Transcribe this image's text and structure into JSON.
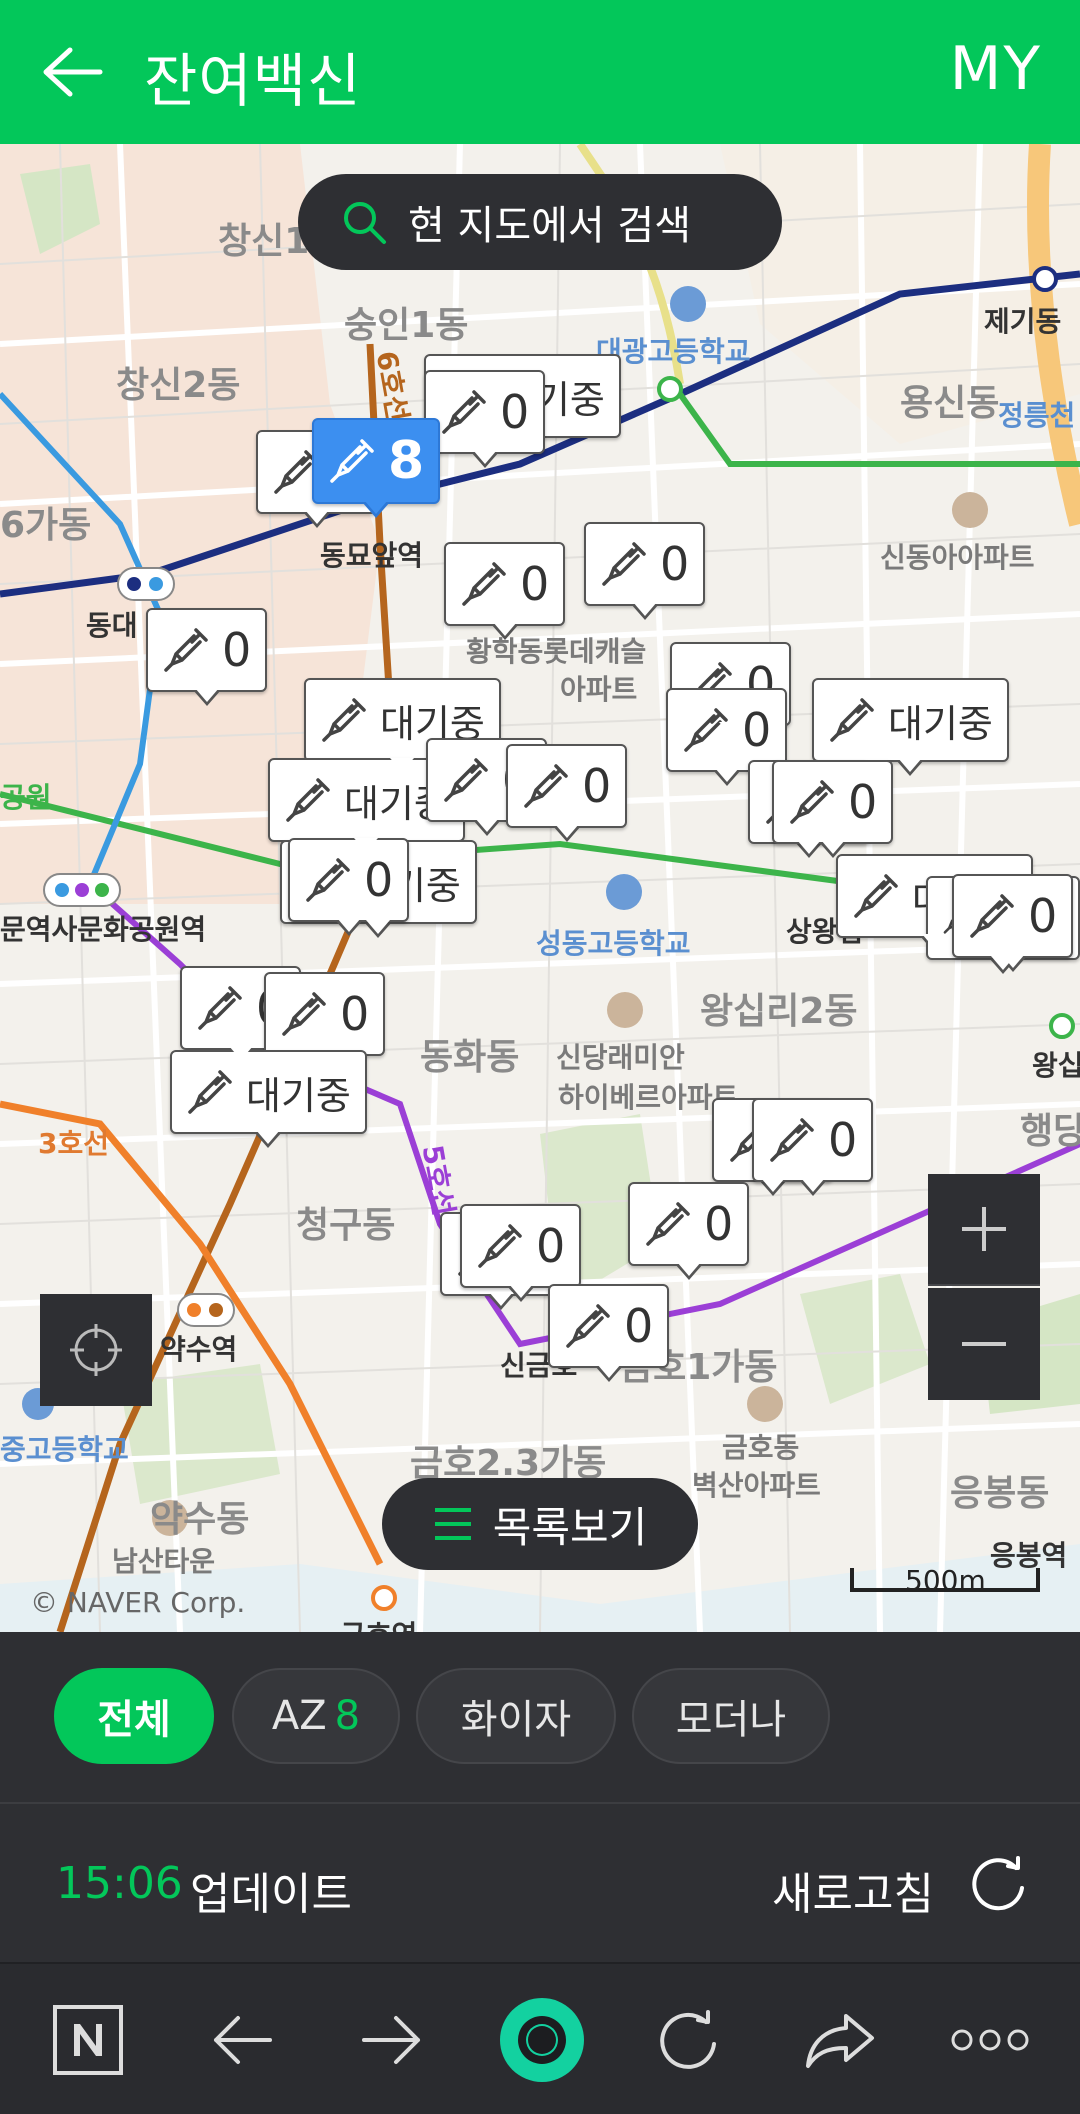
{
  "header": {
    "title": "잔여백신",
    "my_label": "MY"
  },
  "map": {
    "search_label": "현 지도에서 검색",
    "list_view_label": "목록보기",
    "copyright": "© NAVER Corp.",
    "scale_label": "500m",
    "places": {
      "changsin1": "창신1",
      "sungin1": "숭인1동",
      "changsin2": "창신2동",
      "dong6ga": "6가동",
      "dongdaemun": "동대",
      "dongmyo": "동묘앞역",
      "daegwang": "대광고등학교",
      "yongsin": "용신동",
      "jegi": "제기동",
      "jeongneung": "정릉천",
      "sindong_apt": "신동아아파트",
      "hwanghak": "황학동롯데캐슬",
      "hwanghak2": "아파트",
      "station_cultural": "문역사문화공원역",
      "sindang_high": "성동고등학교",
      "wangsimni2": "왕십리2동",
      "sangwang": "상왕십",
      "donghwa": "동화동",
      "sindang_raemian": "신당래미안",
      "sindang_raemian2": "하이베르아파트",
      "cheonggu": "청구동",
      "yaksu": "약수역",
      "sinkeumho": "신금호",
      "geumho1": "금호1가동",
      "geumho_apt": "금호동",
      "geumho_apt2": "벽산아파트",
      "geumho23": "금호2.3가동",
      "yaksu_dong": "약수동",
      "namsan": "남산타운",
      "eungbong": "응봉동",
      "eungbong_st": "응봉역",
      "haengdang": "행당",
      "wangsim": "왕십",
      "line3": "3호선",
      "line5": "5호선",
      "line6": "6호선",
      "gongwon": "공원",
      "jung_high": "중고등학교",
      "geumho_st": "금호역"
    },
    "markers": {
      "selected": "8",
      "zero": "0",
      "waiting": "대기중"
    }
  },
  "filters": {
    "all": "전체",
    "az": "AZ",
    "az_count": "8",
    "pfizer": "화이자",
    "moderna": "모더나"
  },
  "update": {
    "time": "15:06",
    "label": "업데이트",
    "refresh": "새로고침"
  },
  "colors": {
    "brand": "#03c75a",
    "panel": "#2e2f33",
    "selected_marker": "#3c8ff0"
  },
  "icons": {
    "back": "arrow-left-icon",
    "search": "search-icon",
    "list": "list-icon",
    "location": "crosshair-icon",
    "zoom_in": "plus-icon",
    "zoom_out": "minus-icon",
    "refresh": "refresh-icon",
    "syringe": "syringe-icon"
  }
}
